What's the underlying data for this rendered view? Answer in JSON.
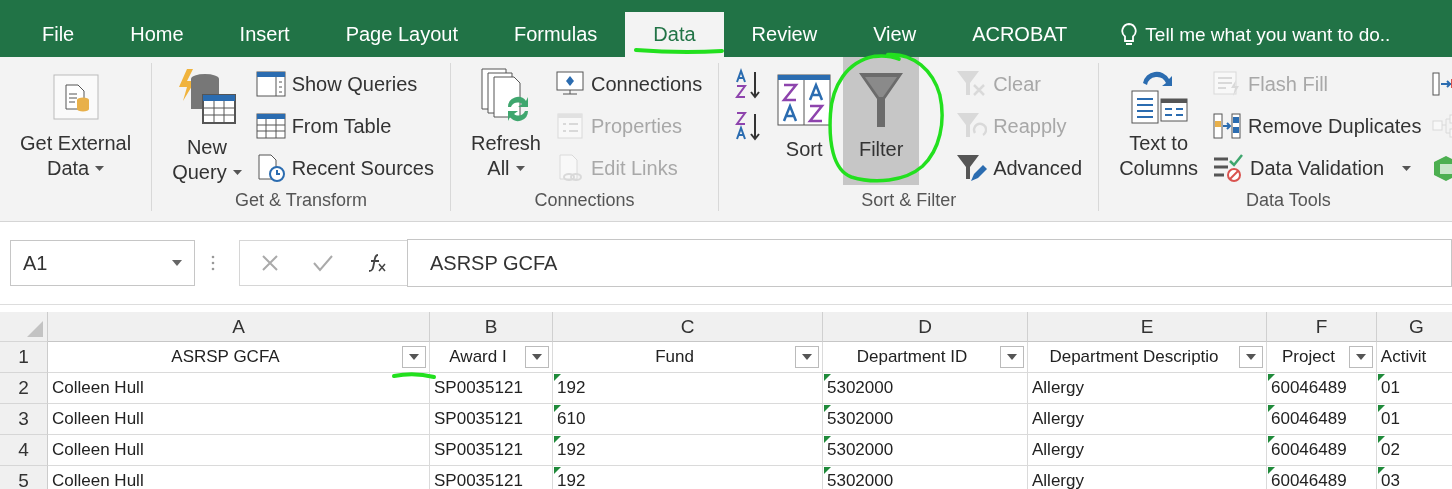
{
  "tabs": [
    {
      "label": "File",
      "selected": false
    },
    {
      "label": "Home",
      "selected": false
    },
    {
      "label": "Insert",
      "selected": false
    },
    {
      "label": "Page Layout",
      "selected": false
    },
    {
      "label": "Formulas",
      "selected": false
    },
    {
      "label": "Data",
      "selected": true
    },
    {
      "label": "Review",
      "selected": false
    },
    {
      "label": "View",
      "selected": false
    },
    {
      "label": "ACROBAT",
      "selected": false
    }
  ],
  "tell_me": "Tell me what you want to do..",
  "ribbon": [
    {
      "controls": [
        {
          "kind": "large",
          "lines": [
            "Get External",
            "Data"
          ],
          "dropdown": true,
          "selected": false
        }
      ]
    },
    {
      "label": "Get & Transform",
      "controls": [
        {
          "kind": "large",
          "lines": [
            "New",
            "Query"
          ],
          "dropdown": true,
          "selected": false
        },
        {
          "kind": "stack",
          "items": [
            {
              "label": "Show Queries",
              "disabled": false,
              "dropdown": false
            },
            {
              "label": "From Table",
              "disabled": false,
              "dropdown": false
            },
            {
              "label": "Recent Sources",
              "disabled": false,
              "dropdown": false
            }
          ]
        }
      ]
    },
    {
      "label": "Connections",
      "controls": [
        {
          "kind": "large",
          "lines": [
            "Refresh",
            "All"
          ],
          "dropdown": true,
          "selected": false
        },
        {
          "kind": "stack",
          "items": [
            {
              "label": "Connections",
              "disabled": false,
              "dropdown": false
            },
            {
              "label": "Properties",
              "disabled": true,
              "dropdown": false
            },
            {
              "label": "Edit Links",
              "disabled": true,
              "dropdown": false
            }
          ]
        }
      ]
    },
    {
      "label": "Sort & Filter",
      "controls": [
        {
          "kind": "stack",
          "items": [
            {
              "disabled": false,
              "dropdown": false
            },
            {
              "disabled": false,
              "dropdown": false
            }
          ]
        },
        {
          "kind": "large",
          "lines": [
            "Sort"
          ],
          "dropdown": false,
          "selected": false
        },
        {
          "kind": "large",
          "lines": [
            "Filter"
          ],
          "dropdown": false,
          "selected": true
        },
        {
          "kind": "stack",
          "items": [
            {
              "label": "Clear",
              "disabled": true,
              "dropdown": false
            },
            {
              "label": "Reapply",
              "disabled": true,
              "dropdown": false
            },
            {
              "label": "Advanced",
              "disabled": false,
              "dropdown": false
            }
          ]
        }
      ]
    },
    {
      "label": "Data Tools",
      "controls": [
        {
          "kind": "large",
          "lines": [
            "Text to",
            "Columns"
          ],
          "dropdown": false,
          "selected": false
        },
        {
          "kind": "stack",
          "items": [
            {
              "label": "Flash Fill",
              "disabled": true,
              "dropdown": false
            },
            {
              "label": "Remove Duplicates",
              "disabled": false,
              "dropdown": false
            },
            {
              "label": "Data Validation",
              "disabled": false,
              "dropdown": true
            }
          ]
        },
        {
          "kind": "stack",
          "items": [
            {
              "disabled": false,
              "dropdown": false
            },
            {
              "disabled": true,
              "dropdown": false
            },
            {
              "disabled": false,
              "dropdown": false
            }
          ]
        }
      ]
    }
  ],
  "name_box": "A1",
  "formula": "ASRSP GCFA",
  "columns": [
    {
      "letter": "A",
      "header": "ASRSP GCFA",
      "filter": true
    },
    {
      "letter": "B",
      "header": "Award I",
      "filter": true
    },
    {
      "letter": "C",
      "header": "Fund",
      "filter": true
    },
    {
      "letter": "D",
      "header": "Department ID",
      "filter": true
    },
    {
      "letter": "E",
      "header": "Department Descriptio",
      "filter": true
    },
    {
      "letter": "F",
      "header": "Project",
      "filter": true
    },
    {
      "letter": "G",
      "header": "Activit",
      "filter": false
    }
  ],
  "header_row": "1",
  "rows": [
    {
      "number": "2",
      "cells": [
        {
          "text": "Colleen Hull",
          "warning": false
        },
        {
          "text": "SP0035121",
          "warning": false
        },
        {
          "text": "192",
          "warning": true
        },
        {
          "text": "5302000",
          "warning": true
        },
        {
          "text": "Allergy",
          "warning": false
        },
        {
          "text": "60046489",
          "warning": true
        },
        {
          "text": "01",
          "warning": true
        }
      ]
    },
    {
      "number": "3",
      "cells": [
        {
          "text": "Colleen Hull",
          "warning": false
        },
        {
          "text": "SP0035121",
          "warning": false
        },
        {
          "text": "610",
          "warning": true
        },
        {
          "text": "5302000",
          "warning": true
        },
        {
          "text": "Allergy",
          "warning": false
        },
        {
          "text": "60046489",
          "warning": true
        },
        {
          "text": "01",
          "warning": true
        }
      ]
    },
    {
      "number": "4",
      "cells": [
        {
          "text": "Colleen Hull",
          "warning": false
        },
        {
          "text": "SP0035121",
          "warning": false
        },
        {
          "text": "192",
          "warning": true
        },
        {
          "text": "5302000",
          "warning": true
        },
        {
          "text": "Allergy",
          "warning": false
        },
        {
          "text": "60046489",
          "warning": true
        },
        {
          "text": "02",
          "warning": true
        }
      ]
    },
    {
      "number": "5",
      "cells": [
        {
          "text": "Colleen Hull",
          "warning": false
        },
        {
          "text": "SP0035121",
          "warning": false
        },
        {
          "text": "192",
          "warning": true
        },
        {
          "text": "5302000",
          "warning": true
        },
        {
          "text": "Allergy",
          "warning": false
        },
        {
          "text": "60046489",
          "warning": true
        },
        {
          "text": "03",
          "warning": true
        }
      ]
    }
  ]
}
